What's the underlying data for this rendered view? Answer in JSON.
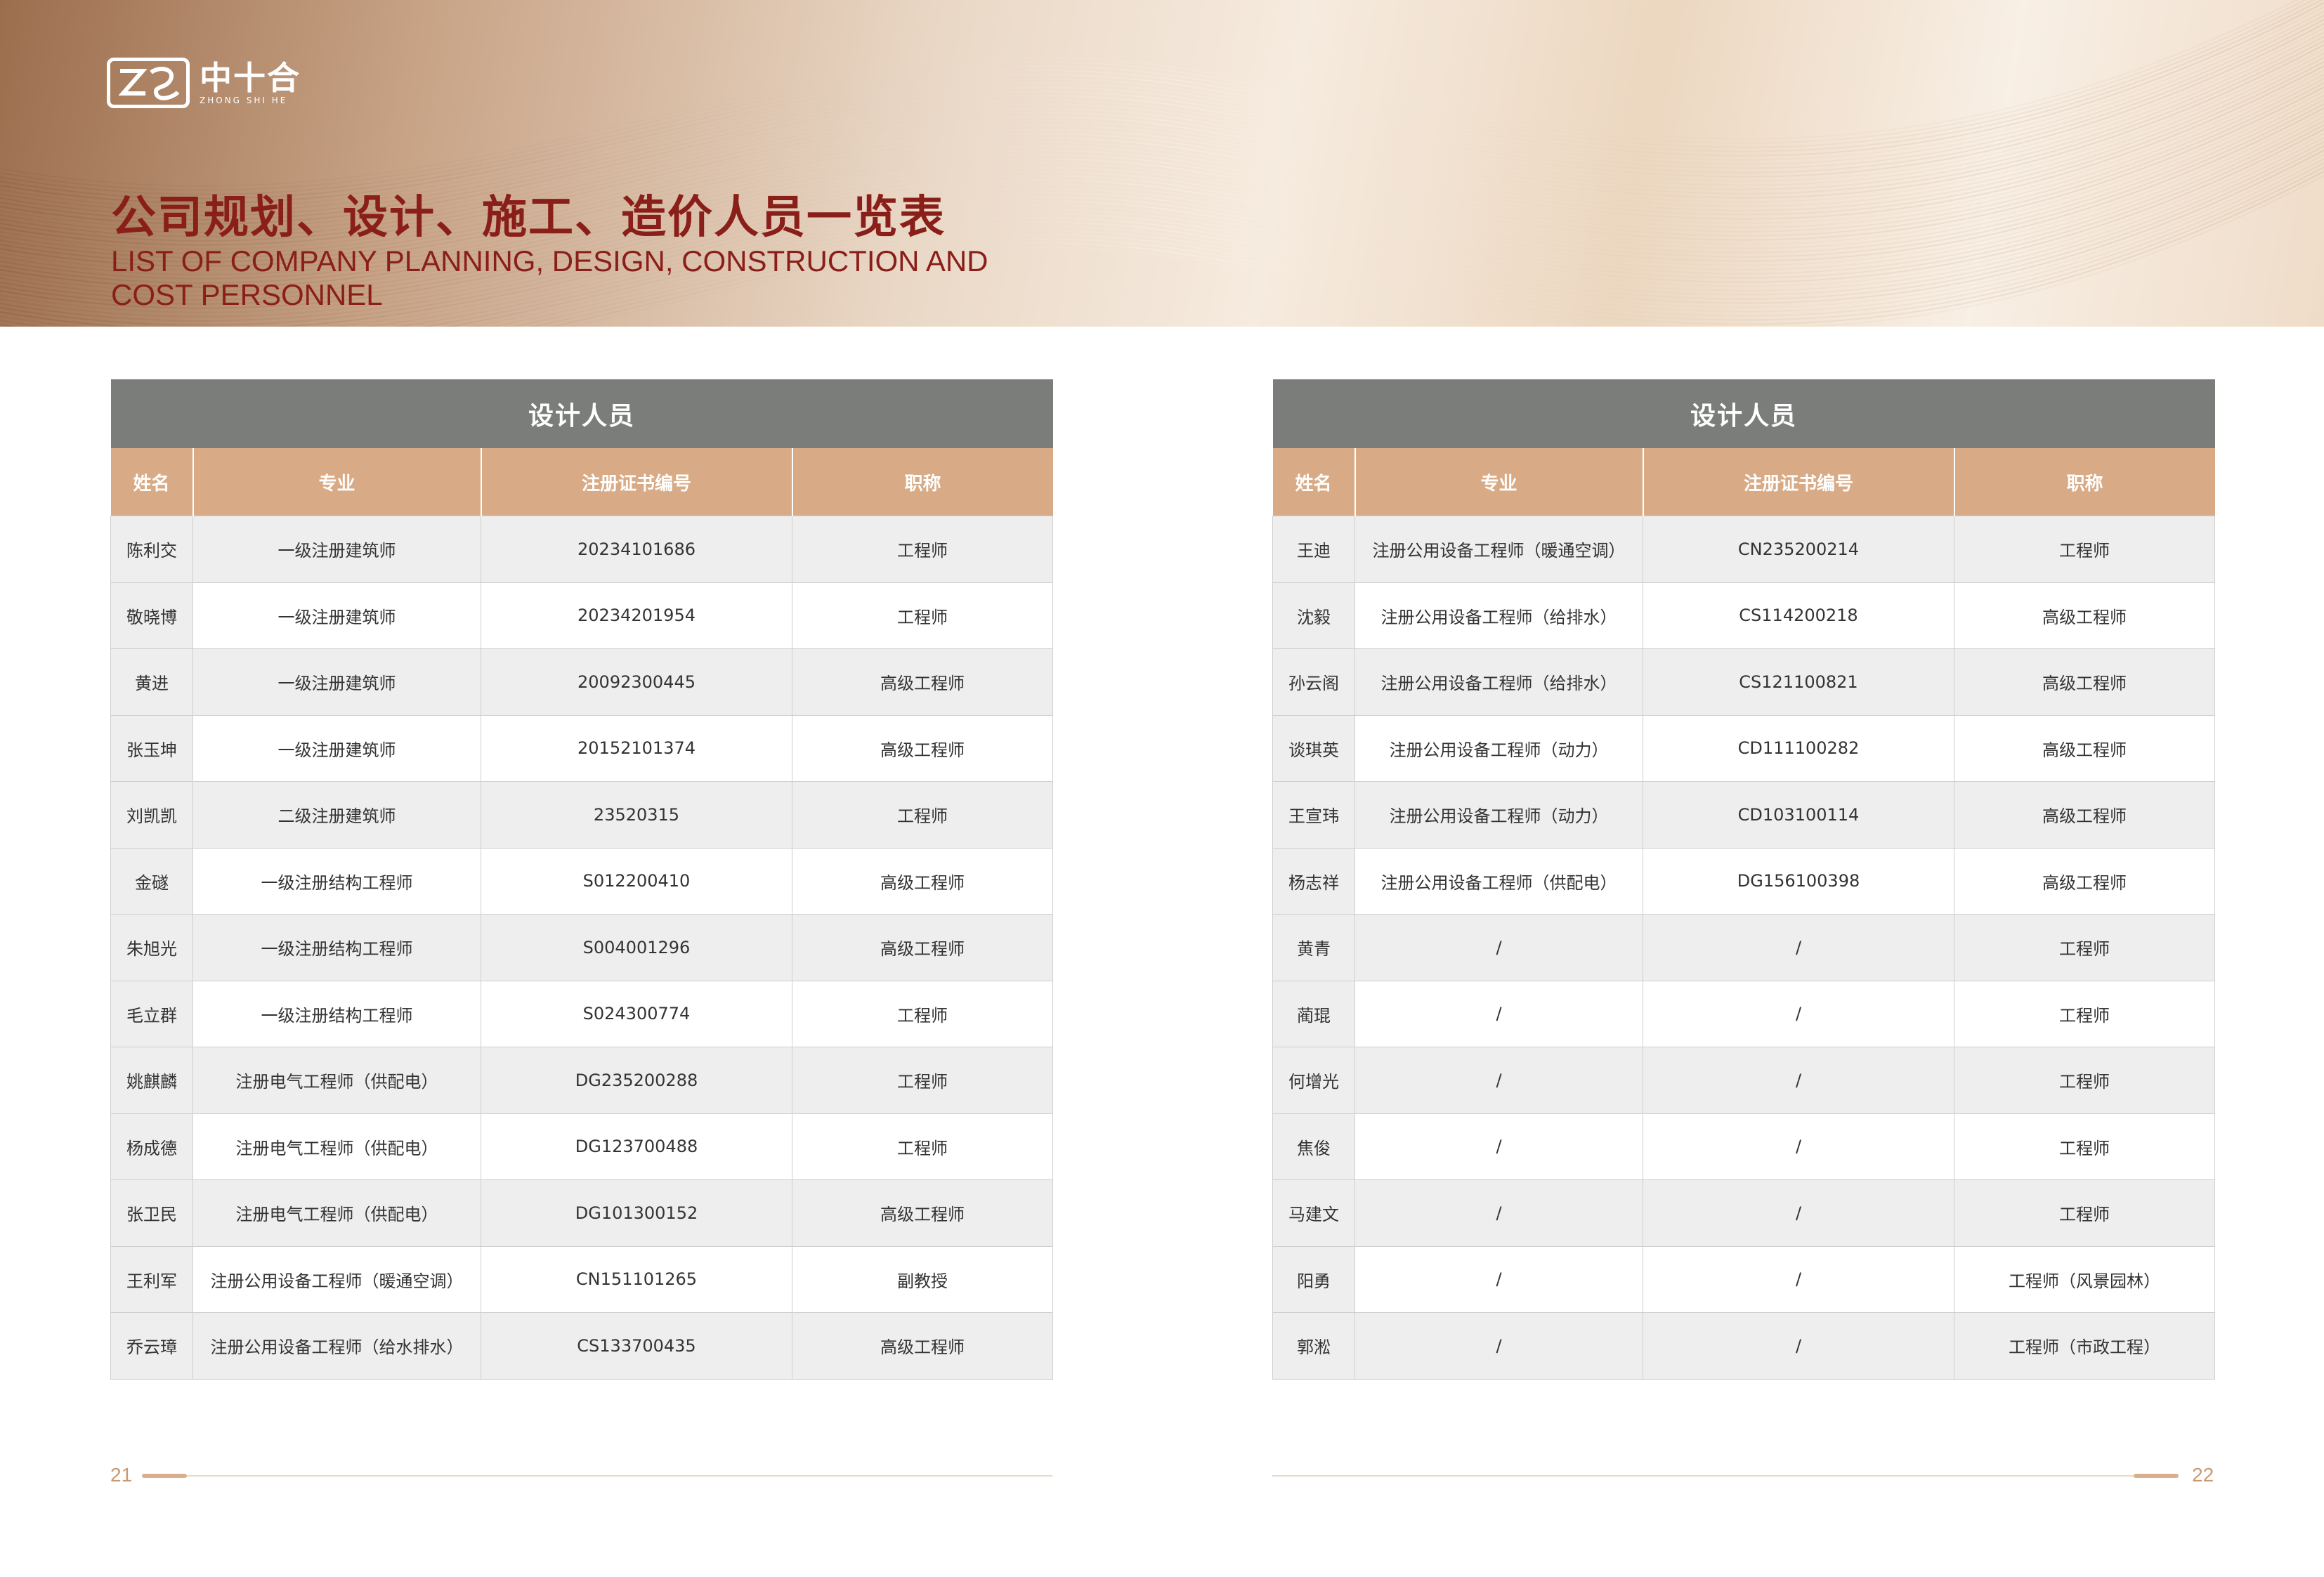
{
  "header": {
    "logo_cn": "中十合",
    "logo_en": "ZHONG SHI HE",
    "title_cn": "公司规划、设计、施工、造价人员一览表",
    "title_en": "LIST OF COMPANY PLANNING, DESIGN, CONSTRUCTION AND COST PERSONNEL"
  },
  "colors": {
    "title": "#8a1f1a",
    "table_title_bg": "#7b7d7b",
    "table_header_bg": "#d8ab86",
    "accent": "#d8b08c"
  },
  "left_table": {
    "title": "设计人员",
    "columns": [
      "姓名",
      "专业",
      "注册证书编号",
      "职称"
    ],
    "rows": [
      [
        "陈利交",
        "一级注册建筑师",
        "20234101686",
        "工程师"
      ],
      [
        "敬晓博",
        "一级注册建筑师",
        "20234201954",
        "工程师"
      ],
      [
        "黄进",
        "一级注册建筑师",
        "20092300445",
        "高级工程师"
      ],
      [
        "张玉坤",
        "一级注册建筑师",
        "20152101374",
        "高级工程师"
      ],
      [
        "刘凯凯",
        "二级注册建筑师",
        "23520315",
        "工程师"
      ],
      [
        "金礈",
        "一级注册结构工程师",
        "S012200410",
        "高级工程师"
      ],
      [
        "朱旭光",
        "一级注册结构工程师",
        "S004001296",
        "高级工程师"
      ],
      [
        "毛立群",
        "一级注册结构工程师",
        "S024300774",
        "工程师"
      ],
      [
        "姚麒麟",
        "注册电气工程师（供配电）",
        "DG235200288",
        "工程师"
      ],
      [
        "杨成德",
        "注册电气工程师（供配电）",
        "DG123700488",
        "工程师"
      ],
      [
        "张卫民",
        "注册电气工程师（供配电）",
        "DG101300152",
        "高级工程师"
      ],
      [
        "王利军",
        "注册公用设备工程师（暖通空调）",
        "CN151101265",
        "副教授"
      ],
      [
        "乔云璋",
        "注册公用设备工程师（给水排水）",
        "CS133700435",
        "高级工程师"
      ]
    ]
  },
  "right_table": {
    "title": "设计人员",
    "columns": [
      "姓名",
      "专业",
      "注册证书编号",
      "职称"
    ],
    "rows": [
      [
        "王迪",
        "注册公用设备工程师（暖通空调）",
        "CN235200214",
        "工程师"
      ],
      [
        "沈毅",
        "注册公用设备工程师（给排水）",
        "CS114200218",
        "高级工程师"
      ],
      [
        "孙云阁",
        "注册公用设备工程师（给排水）",
        "CS121100821",
        "高级工程师"
      ],
      [
        "谈琪英",
        "注册公用设备工程师（动力）",
        "CD111100282",
        "高级工程师"
      ],
      [
        "王宣玮",
        "注册公用设备工程师（动力）",
        "CD103100114",
        "高级工程师"
      ],
      [
        "杨志祥",
        "注册公用设备工程师（供配电）",
        "DG156100398",
        "高级工程师"
      ],
      [
        "黄青",
        "/",
        "/",
        "工程师"
      ],
      [
        "蔺琨",
        "/",
        "/",
        "工程师"
      ],
      [
        "何增光",
        "/",
        "/",
        "工程师"
      ],
      [
        "焦俊",
        "/",
        "/",
        "工程师"
      ],
      [
        "马建文",
        "/",
        "/",
        "工程师"
      ],
      [
        "阳勇",
        "/",
        "/",
        "工程师（风景园林）"
      ],
      [
        "郭淞",
        "/",
        "/",
        "工程师（市政工程）"
      ]
    ]
  },
  "footer": {
    "left_page": "21",
    "right_page": "22"
  }
}
